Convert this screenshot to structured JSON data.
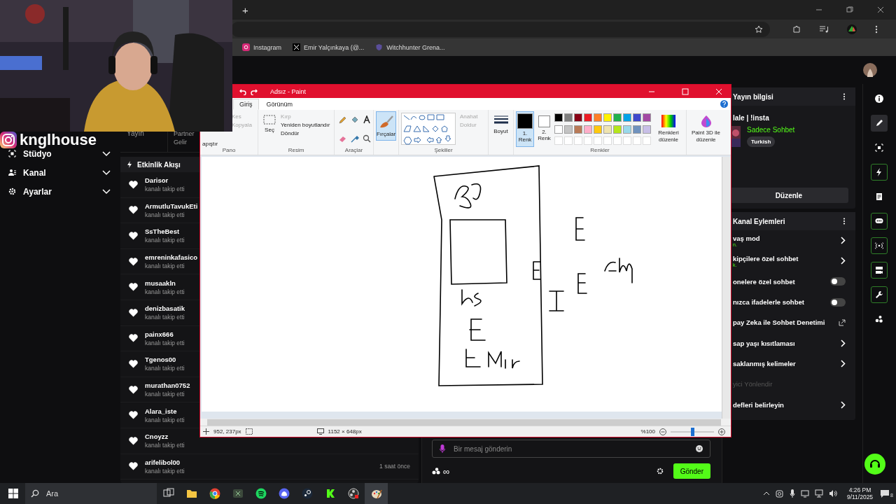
{
  "browser": {
    "new_tab": "+",
    "bookmarks": [
      {
        "label": "Instagram",
        "kind": "instagram"
      },
      {
        "label": "Emir Yalçınkaya (@...",
        "kind": "x"
      },
      {
        "label": "Witchhunter Grena...",
        "kind": "shield"
      }
    ]
  },
  "overlay": {
    "handle": "knglhouse"
  },
  "sidebar": {
    "items": [
      {
        "label": "Stüdyo",
        "kind": "studio"
      },
      {
        "label": "Kanal",
        "kind": "people"
      },
      {
        "label": "Ayarlar",
        "kind": "gear"
      }
    ]
  },
  "tabs": [
    "Yayın",
    "Partner Gelir"
  ],
  "activity": {
    "title": "Etkinlik Akışı",
    "events": [
      {
        "user": "Darisor",
        "action": "kanalı takip etti"
      },
      {
        "user": "ArmutluTavukEti",
        "action": "kanalı takip etti"
      },
      {
        "user": "SsTheBest",
        "action": "kanalı takip etti"
      },
      {
        "user": "emreninkafasico",
        "action": "kanalı takip etti"
      },
      {
        "user": "musaakln",
        "action": "kanalı takip etti"
      },
      {
        "user": "denizbasatik",
        "action": "kanalı takip etti"
      },
      {
        "user": "painx666",
        "action": "kanalı takip etti"
      },
      {
        "user": "Tgenos00",
        "action": "kanalı takip etti"
      },
      {
        "user": "murathan0752",
        "action": "kanalı takip etti"
      },
      {
        "user": "Alara_iste",
        "action": "kanalı takip etti"
      },
      {
        "user": "Cnoyzz",
        "action": "kanalı takip etti"
      },
      {
        "user": "arifelibol00",
        "action": "kanalı takip etti",
        "time": "1 saat önce"
      }
    ]
  },
  "chat": {
    "placeholder": "Bir mesaj gönderin",
    "infinity": "∞",
    "send": "Gönder"
  },
  "stream_info": {
    "title": "Yayın bilgisi",
    "stream_title": "lale | !insta",
    "category": "Sadece Sohbet",
    "tag": "Turkish",
    "edit": "Düzenle"
  },
  "channel_actions": {
    "title": "Kanal Eylemleri",
    "items": [
      {
        "label": "vaş mod",
        "note": "n.",
        "kind": "arrow"
      },
      {
        "label": "kipçilere özel sohbet",
        "note": "k.",
        "kind": "arrow"
      },
      {
        "label": "onelere özel sohbet",
        "kind": "toggle",
        "on": false
      },
      {
        "label": "nızca ifadelerle sohbet",
        "kind": "toggle",
        "on": false
      },
      {
        "label": "pay Zeka ile Sohbet Denetimi",
        "kind": "external"
      },
      {
        "label": "sap yaşı kısıtlaması",
        "kind": "arrow"
      },
      {
        "label": "saklanmış kelimeler",
        "kind": "arrow"
      },
      {
        "label": "yici Yönlendir",
        "kind": "heading"
      },
      {
        "label": "defleri belirleyin",
        "kind": "arrow"
      }
    ]
  },
  "rail": [
    {
      "kind": "info",
      "selected": false,
      "highlighted": false
    },
    {
      "kind": "pencil",
      "selected": true,
      "highlighted": false
    },
    {
      "kind": "studio",
      "selected": false,
      "highlighted": false
    },
    {
      "kind": "bolt",
      "selected": false,
      "highlighted": true
    },
    {
      "kind": "note",
      "selected": false,
      "highlighted": false
    },
    {
      "kind": "chat",
      "selected": false,
      "highlighted": true
    },
    {
      "kind": "broadcast",
      "selected": false,
      "highlighted": true
    },
    {
      "kind": "camera",
      "selected": false,
      "highlighted": true
    },
    {
      "kind": "wrench",
      "selected": false,
      "highlighted": true
    },
    {
      "kind": "dots",
      "selected": false,
      "highlighted": false
    }
  ],
  "paint": {
    "title": "Adsız - Paint",
    "menu": [
      {
        "label": "Giriş",
        "selected": true
      },
      {
        "label": "Görünüm",
        "selected": false
      }
    ],
    "ribbon": {
      "clipboard": {
        "label": "Pano",
        "paste": "apıştır",
        "cut": {
          "label": "Kes",
          "disabled": true
        },
        "copy": {
          "label": "Kopyala",
          "disabled": true
        }
      },
      "image": {
        "label": "Resim",
        "select": "Seç",
        "crop": "Kırp",
        "resize": "Yeniden boyutlandır",
        "rotate": "Döndür"
      },
      "tools": {
        "label": "Araçlar"
      },
      "brushes": {
        "label": "Fırçalar",
        "selected": true
      },
      "shapes": {
        "label": "Şekiller",
        "outline": {
          "label": "Anahat",
          "disabled": true
        },
        "fill": {
          "label": "Doldur",
          "disabled": true
        }
      },
      "size": {
        "label": "Boyut"
      },
      "colors": {
        "label": "Renkler",
        "color1": {
          "label": "1. Renk",
          "color": "#000000",
          "selected": true
        },
        "color2": {
          "label": "2. Renk",
          "color": "#ffffff",
          "selected": false
        },
        "palette": [
          {
            "color": "#000000"
          },
          {
            "color": "#7f7f7f"
          },
          {
            "color": "#880015"
          },
          {
            "color": "#ed1c24"
          },
          {
            "color": "#ff7f27"
          },
          {
            "color": "#fff200"
          },
          {
            "color": "#22b14c"
          },
          {
            "color": "#00a2e8"
          },
          {
            "color": "#3f48cc"
          },
          {
            "color": "#a349a4"
          },
          {
            "color": "#ffffff"
          },
          {
            "color": "#c3c3c3"
          },
          {
            "color": "#b97a57"
          },
          {
            "color": "#ffaec9"
          },
          {
            "color": "#ffc90e"
          },
          {
            "color": "#efe4b0"
          },
          {
            "color": "#b5e61d"
          },
          {
            "color": "#99d9ea"
          },
          {
            "color": "#7092be"
          },
          {
            "color": "#c8bfe7"
          }
        ],
        "edit": "Renkleri düzenle"
      },
      "paint3d": "Paint 3D ile düzenle"
    },
    "status": {
      "cursor": "952, 237px",
      "size": "1152 × 648px",
      "zoom": "%100",
      "level": 0.5
    }
  },
  "taskbar": {
    "search": "Ara",
    "apps": [
      {
        "kind": "task-view",
        "selected": false
      },
      {
        "kind": "folder",
        "selected": false
      },
      {
        "kind": "chrome",
        "selected": false
      },
      {
        "kind": "xbox",
        "selected": false
      },
      {
        "kind": "spotify",
        "selected": false
      },
      {
        "kind": "discord",
        "selected": false
      },
      {
        "kind": "steam",
        "selected": false
      },
      {
        "kind": "kick",
        "selected": false
      },
      {
        "kind": "obs",
        "selected": false
      },
      {
        "kind": "paint",
        "selected": true
      }
    ],
    "time": "4:26 PM",
    "date": "9/11/2025",
    "notifications": "8"
  }
}
